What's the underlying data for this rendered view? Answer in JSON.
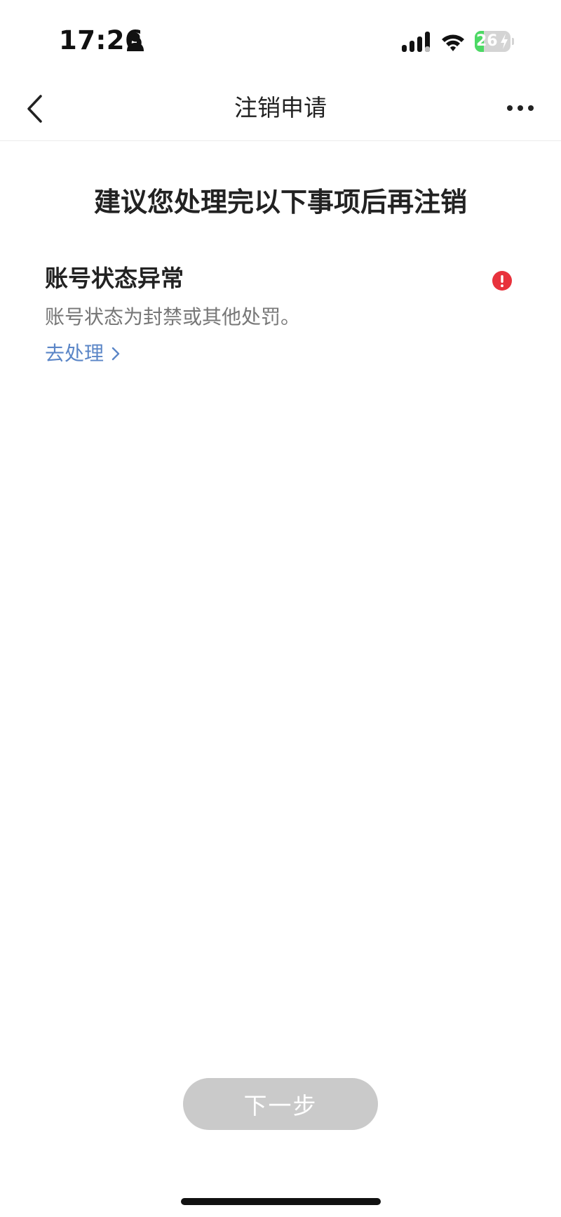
{
  "status_bar": {
    "time": "17:26",
    "battery_level": "26",
    "battery_fraction": 0.26,
    "icons": [
      "person-icon",
      "cellular-signal-icon",
      "wifi-icon",
      "battery-icon",
      "charging-bolt-icon"
    ]
  },
  "nav": {
    "title": "注销申请",
    "back_icon": "chevron-left-icon",
    "more_icon": "more-dots-icon"
  },
  "main": {
    "headline": "建议您处理完以下事项后再注销",
    "issues": [
      {
        "title": "账号状态异常",
        "description": "账号状态为封禁或其他处罚。",
        "action_label": "去处理",
        "status_icon": "alert-icon",
        "status_color": "#e8323c"
      }
    ]
  },
  "footer": {
    "next_label": "下一步"
  },
  "colors": {
    "link": "#5b86c7",
    "alert": "#e8323c",
    "button_disabled": "#cacaca",
    "battery_fill": "#4cd964"
  }
}
